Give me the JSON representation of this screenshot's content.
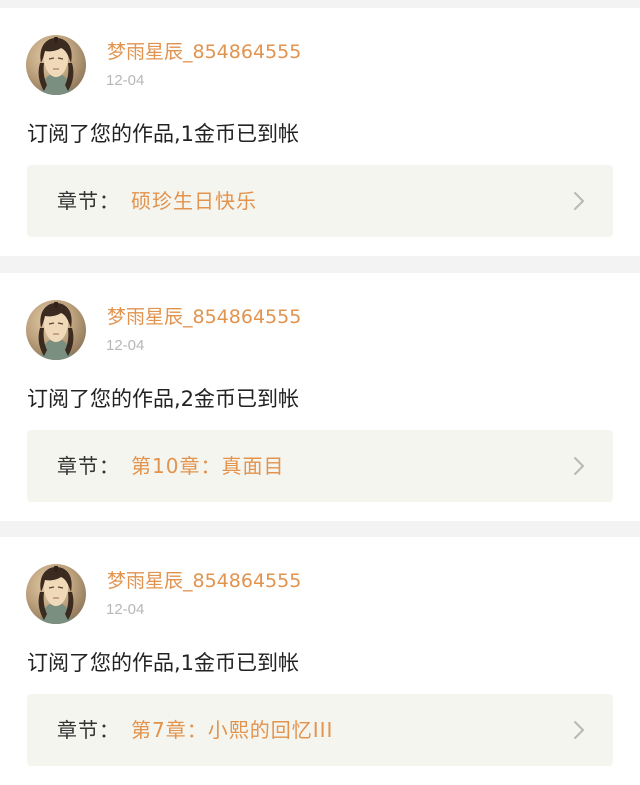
{
  "notifications": [
    {
      "username": "梦雨星辰_854864555",
      "date": "12-04",
      "message": "订阅了您的作品,1金币已到帐",
      "chapter_label": "章节：",
      "chapter_title": "硕珍生日快乐",
      "avatar_icon": "warrior-portrait-avatar",
      "chevron_icon": "chevron-right-icon"
    },
    {
      "username": "梦雨星辰_854864555",
      "date": "12-04",
      "message": "订阅了您的作品,2金币已到帐",
      "chapter_label": "章节：",
      "chapter_title": "第10章：真面目",
      "avatar_icon": "warrior-portrait-avatar",
      "chevron_icon": "chevron-right-icon"
    },
    {
      "username": "梦雨星辰_854864555",
      "date": "12-04",
      "message": "订阅了您的作品,1金币已到帐",
      "chapter_label": "章节：",
      "chapter_title": "第7章：小熙的回忆III",
      "avatar_icon": "warrior-portrait-avatar",
      "chevron_icon": "chevron-right-icon"
    }
  ],
  "colors": {
    "accent": "#e2934e",
    "page_background": "#f3f3f3",
    "card_background": "#ffffff",
    "chapter_box_background": "#f5f5ef",
    "secondary_text": "#b7b7b7",
    "primary_text": "#222222"
  }
}
